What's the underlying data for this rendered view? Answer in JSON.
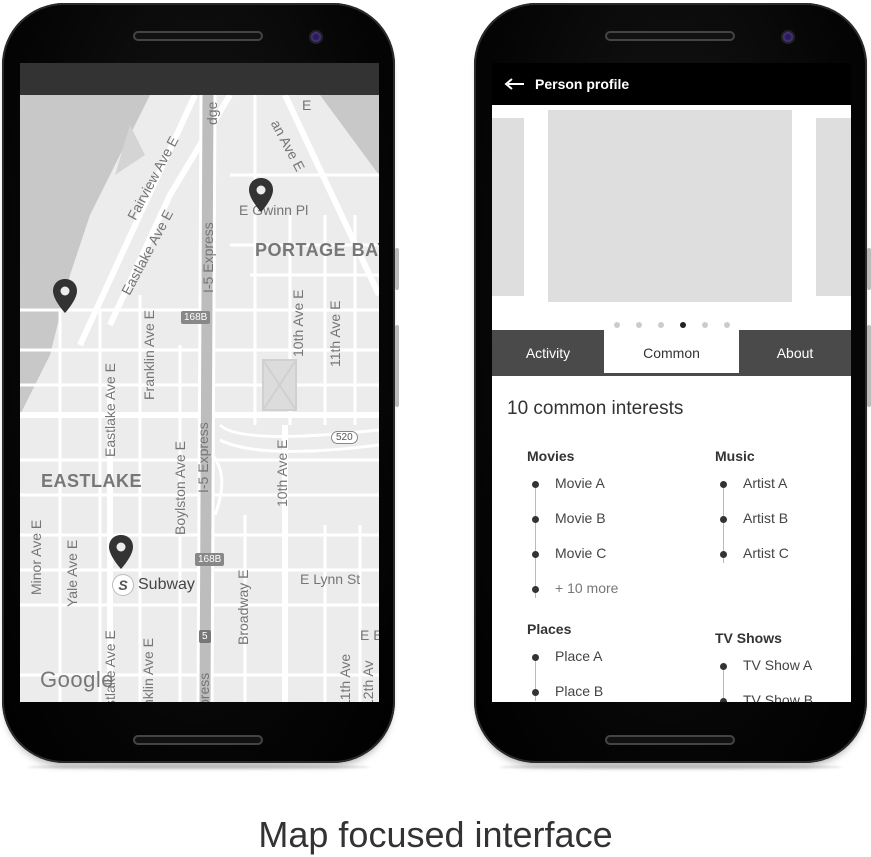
{
  "caption": "Map focused interface",
  "map_screen": {
    "labels": {
      "fairview": "Fairview Ave E",
      "eastlake_e": "Eastlake Ave E",
      "gwinn": "E Gwinn Pl",
      "portage_bay": "PORTAGE BAY",
      "i5_top": "I-5 Express",
      "i5_bottom": "I-5 Express",
      "express_bottom": "press",
      "tenth_top": "10th Ave E",
      "eleventh_top": "11th Ave E",
      "franklin": "Franklin Ave E",
      "eastlake_v": "Eastlake Ave E",
      "eastlake_area": "EASTLAKE",
      "boylston": "Boylston Ave E",
      "tenth_bottom": "10th Ave E",
      "minor": "Minor Ave E",
      "yale": "Yale Ave E",
      "broadway": "Broadway E",
      "lynn": "E Lynn St",
      "eastlake_bottom": "stlake Ave E",
      "franklin_bottom": "nklin Ave E",
      "eleventh_bottom": "11th Ave",
      "twelfth_bottom": "12th Av",
      "e_b": "E B",
      "ge": "dge",
      "top_ave": "an Ave E",
      "top_e": "E",
      "shield_168b_top": "168B",
      "shield_168b_bottom": "168B",
      "shield_520": "520",
      "shield_5": "5",
      "subway": "Subway",
      "subway_mark": "S",
      "google": "Google"
    },
    "icons": [
      "map-pin-icon",
      "subway-icon"
    ]
  },
  "profile_screen": {
    "app_bar": {
      "title": "Person profile",
      "back_icon": "back-arrow-icon"
    },
    "carousel": {
      "slide_count": 6,
      "active_index": 3
    },
    "tabs": [
      {
        "label": "Activity",
        "active": false
      },
      {
        "label": "Common",
        "active": true
      },
      {
        "label": "About",
        "active": false
      }
    ],
    "headline": "10 common interests",
    "groups": {
      "movies": {
        "title": "Movies",
        "items": [
          "Movie A",
          "Movie B",
          "Movie C"
        ],
        "more": "+ 10 more"
      },
      "music": {
        "title": "Music",
        "items": [
          "Artist A",
          "Artist B",
          "Artist C"
        ]
      },
      "places": {
        "title": "Places",
        "items": [
          "Place A",
          "Place B"
        ]
      },
      "tv": {
        "title": "TV Shows",
        "items": [
          "TV Show A",
          "TV Show B"
        ]
      }
    }
  },
  "colors": {
    "tab_bar": "#4a4a4a",
    "app_bar": "#000000",
    "map_bg": "#ececec",
    "water": "#c8c8c8"
  }
}
